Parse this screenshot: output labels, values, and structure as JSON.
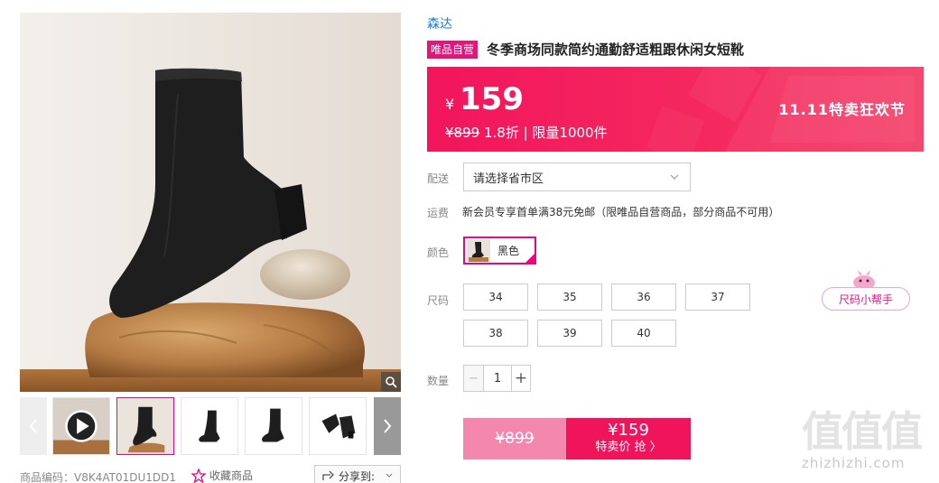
{
  "product": {
    "brand": "森达",
    "self_operated_badge": "唯品自营",
    "title": "冬季商场同款简约通勤舒适粗跟休闲女短靴",
    "code_label": "商品编码：V8K4AT01DU1DD1",
    "favorite_label": "收藏商品",
    "share_label": "分享到:"
  },
  "price": {
    "currency": "¥",
    "current": "159",
    "original": "¥899",
    "discount": "1.8折",
    "limit_text": "| 限量1000件",
    "festival_tag": "11.11特卖狂欢节"
  },
  "delivery": {
    "label": "配送",
    "region_placeholder": "请选择省市区"
  },
  "shipping": {
    "label": "运费",
    "text": "新会员专享首单满38元免邮（限唯品自营商品，部分商品不可用）"
  },
  "color": {
    "label": "颜色",
    "selected": "黑色"
  },
  "size": {
    "label": "尺码",
    "options": [
      "34",
      "35",
      "36",
      "37",
      "38",
      "39",
      "40"
    ],
    "helper_label": "尺码小帮手"
  },
  "quantity": {
    "label": "数量",
    "value": "1",
    "minus": "−",
    "plus": "+"
  },
  "buy": {
    "original_price": "¥899",
    "current_price": "¥159",
    "cta_label": "特卖价 抢 〉"
  },
  "watermark": {
    "logo": "值值值",
    "site": "zhizhizhi.com"
  },
  "colors": {
    "accent": "#f10180",
    "banner": "#f2155d",
    "brand_link": "#1a7dd1"
  }
}
